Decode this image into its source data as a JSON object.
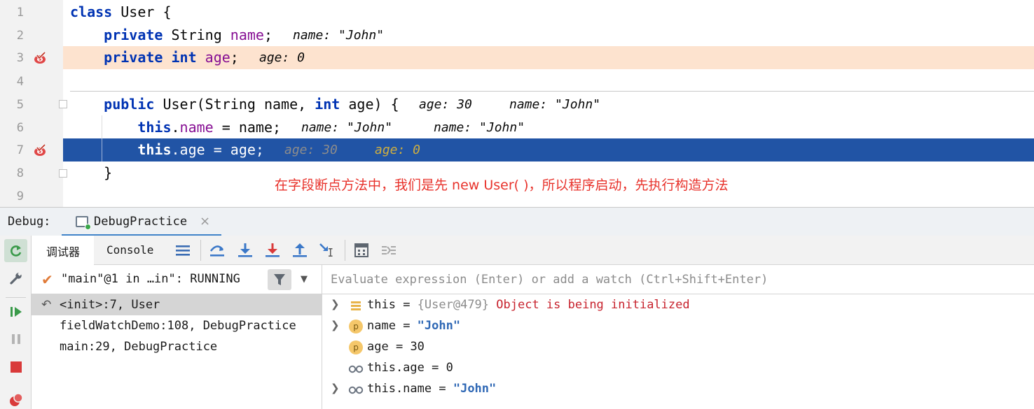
{
  "editor": {
    "lines": [
      {
        "num": "1",
        "code": [
          {
            "t": "class ",
            "c": "kw"
          },
          {
            "t": "User {",
            "c": ""
          }
        ],
        "hints": []
      },
      {
        "num": "2",
        "code": [
          {
            "t": "    private ",
            "c": "kw"
          },
          {
            "t": "String ",
            "c": ""
          },
          {
            "t": "name",
            "c": "fld"
          },
          {
            "t": ";",
            "c": ""
          }
        ],
        "hints": [
          "name: \"John\""
        ]
      },
      {
        "num": "3",
        "code": [
          {
            "t": "    private int ",
            "c": "kw"
          },
          {
            "t": "age",
            "c": "fld"
          },
          {
            "t": ";",
            "c": ""
          }
        ],
        "hints": [
          "age: 0"
        ]
      },
      {
        "num": "4",
        "code": [],
        "hints": []
      },
      {
        "num": "5",
        "code": [
          {
            "t": "    public ",
            "c": "kw"
          },
          {
            "t": "User(String name, ",
            "c": ""
          },
          {
            "t": "int ",
            "c": "kw"
          },
          {
            "t": "age) {",
            "c": ""
          }
        ],
        "hints": [
          "age: 30",
          "name: \"John\""
        ]
      },
      {
        "num": "6",
        "code": [
          {
            "t": "        this",
            "c": "kw"
          },
          {
            "t": ".",
            "c": ""
          },
          {
            "t": "name",
            "c": "fld"
          },
          {
            "t": " = name;",
            "c": ""
          }
        ],
        "hints": [
          "name: \"John\"",
          "name: \"John\""
        ]
      },
      {
        "num": "7",
        "code": [
          {
            "t": "        this",
            "c": "kw"
          },
          {
            "t": ".",
            "c": ""
          },
          {
            "t": "age",
            "c": "fld"
          },
          {
            "t": " = age;",
            "c": ""
          }
        ],
        "hints": [
          "age: 30",
          "age: 0"
        ]
      },
      {
        "num": "8",
        "code": [
          {
            "t": "    }",
            "c": ""
          }
        ],
        "hints": []
      },
      {
        "num": "9",
        "code": [],
        "hints": []
      }
    ],
    "annotation": "在字段断点方法中，我们是先 new User( )，所以程序启动，先执行构造方法"
  },
  "debug": {
    "label": "Debug:",
    "tab_label": "DebugPractice",
    "tab_close": "×"
  },
  "toolbar": {
    "tab_debugger": "调试器",
    "tab_console": "Console"
  },
  "frames": {
    "thread": "\"main\"@1 in …in\": RUNNING",
    "items": [
      {
        "text": "<init>:7, User"
      },
      {
        "text": "fieldWatchDemo:108, DebugPractice"
      },
      {
        "text": "main:29, DebugPractice"
      }
    ]
  },
  "variables": {
    "eval_placeholder": "Evaluate expression (Enter) or add a watch (Ctrl+Shift+Enter)",
    "items": [
      {
        "name": "this",
        "eq": " = ",
        "value": "{User@479}",
        "extra": " Object is being initialized"
      },
      {
        "name": "name",
        "eq": " = ",
        "value": "\"John\"",
        "extra": ""
      },
      {
        "name": "age",
        "eq": " = ",
        "value": "30",
        "extra": ""
      },
      {
        "name": "this.age",
        "eq": " = ",
        "value": "0",
        "extra": ""
      },
      {
        "name": "this.name",
        "eq": " = ",
        "value": "\"John\"",
        "extra": ""
      }
    ]
  },
  "colors": {
    "breakpoint_line": "#fde3cf",
    "execution_line": "#2154a5",
    "annotation": "#e8322b",
    "keyword": "#0033b3"
  }
}
